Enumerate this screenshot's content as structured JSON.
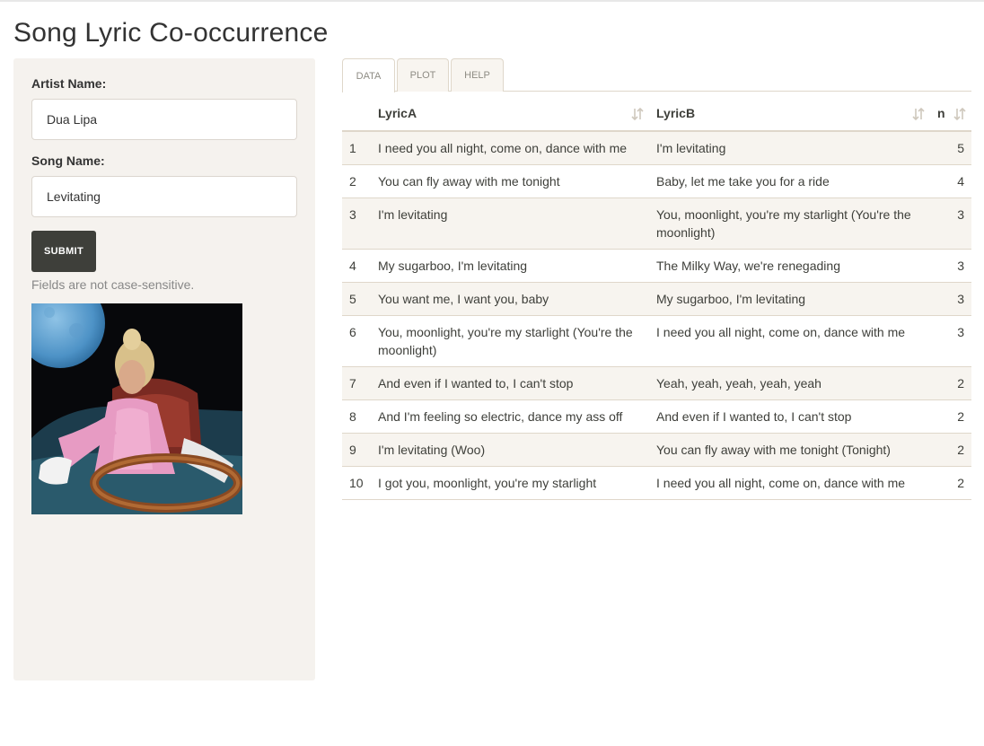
{
  "app": {
    "title": "Song Lyric Co-occurrence"
  },
  "form": {
    "artist_label": "Artist Name:",
    "artist_value": "Dua Lipa",
    "song_label": "Song Name:",
    "song_value": "Levitating",
    "submit_label": "SUBMIT",
    "help_text": "Fields are not case-sensitive."
  },
  "tabs": [
    {
      "label": "DATA",
      "active": true
    },
    {
      "label": "PLOT",
      "active": false
    },
    {
      "label": "HELP",
      "active": false
    }
  ],
  "table": {
    "columns": [
      "",
      "LyricA",
      "LyricB",
      "n"
    ],
    "rows": [
      [
        "1",
        "I need you all night, come on, dance with me",
        "I'm levitating",
        "5"
      ],
      [
        "2",
        "You can fly away with me tonight",
        "Baby, let me take you for a ride",
        "4"
      ],
      [
        "3",
        "I'm levitating",
        "You, moonlight, you're my starlight (You're the moonlight)",
        "3"
      ],
      [
        "4",
        "My sugarboo, I'm levitating",
        "The Milky Way, we're renegading",
        "3"
      ],
      [
        "5",
        "You want me, I want you, baby",
        "My sugarboo, I'm levitating",
        "3"
      ],
      [
        "6",
        "You, moonlight, you're my starlight (You're the moonlight)",
        "I need you all night, come on, dance with me",
        "3"
      ],
      [
        "7",
        "And even if I wanted to, I can't stop",
        "Yeah, yeah, yeah, yeah, yeah",
        "2"
      ],
      [
        "8",
        "And I'm feeling so electric, dance my ass off",
        "And even if I wanted to, I can't stop",
        "2"
      ],
      [
        "9",
        "I'm levitating (Woo)",
        "You can fly away with me tonight (Tonight)",
        "2"
      ],
      [
        "10",
        "I got you, moonlight, you're my starlight",
        "I need you all night, come on, dance with me",
        "2"
      ]
    ]
  },
  "colors": {
    "sidebar_bg": "#f5f2ee",
    "button_bg": "#3e3f3a",
    "stripe_bg": "#f7f4ef",
    "border": "#dfd7ca"
  }
}
